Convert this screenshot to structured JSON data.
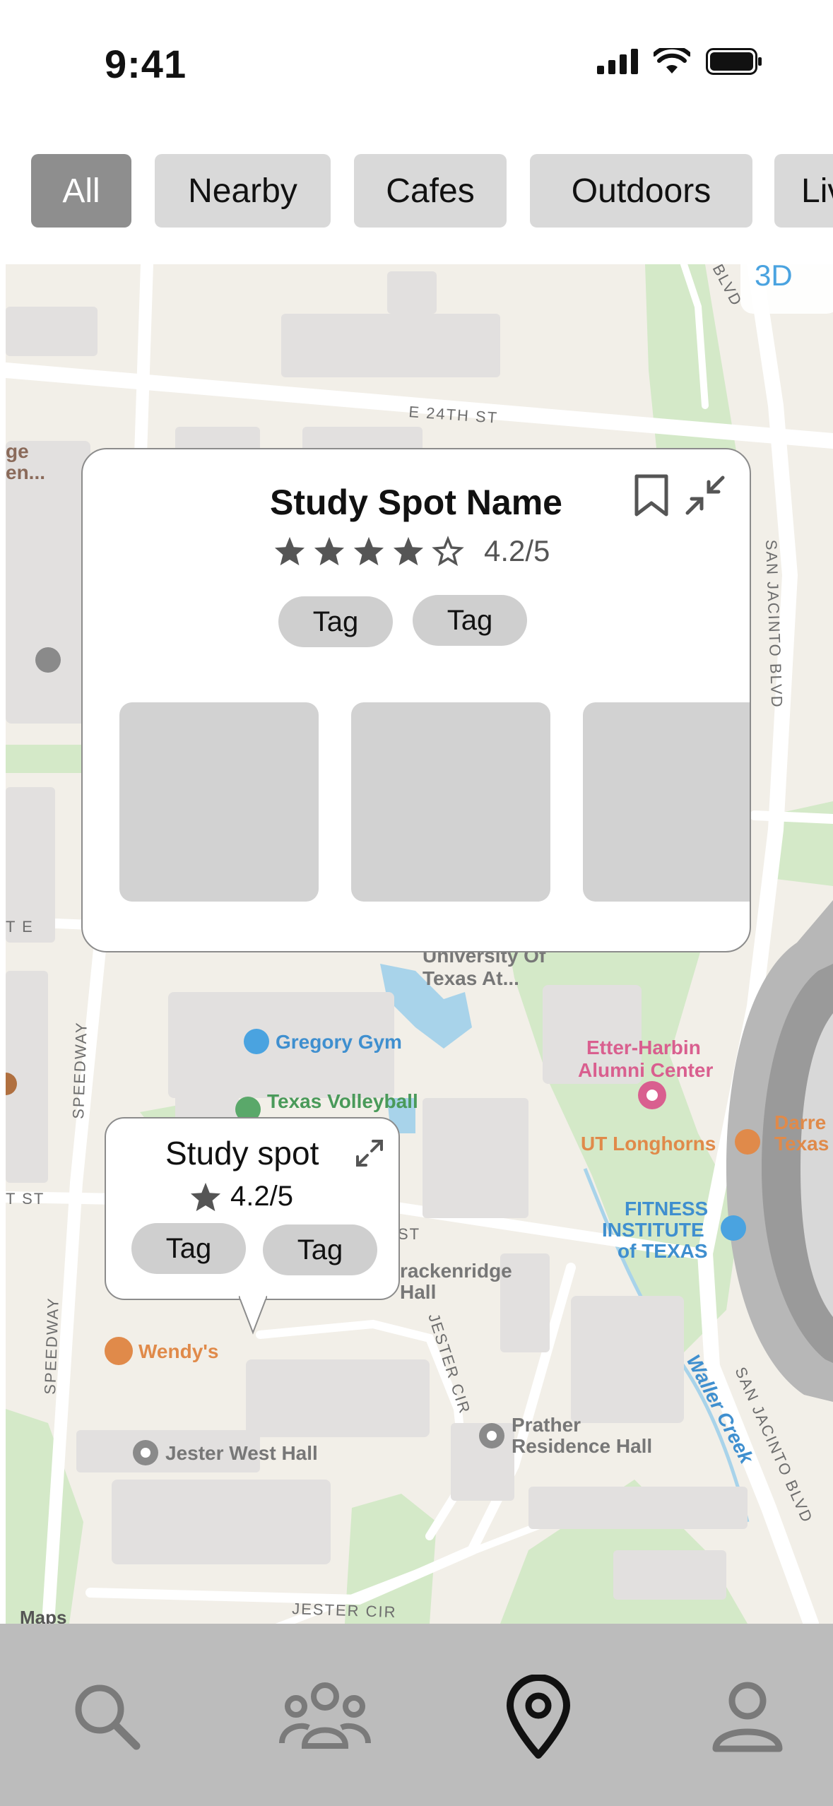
{
  "status_bar": {
    "time": "9:41"
  },
  "filters": {
    "chips": [
      {
        "label": "All",
        "active": true
      },
      {
        "label": "Nearby",
        "active": false
      },
      {
        "label": "Cafes",
        "active": false
      },
      {
        "label": "Outdoors",
        "active": false
      },
      {
        "label": "Liv",
        "active": false
      }
    ]
  },
  "map": {
    "badge_3d": "3D",
    "labels": {
      "e24th": "E 24TH ST",
      "san_jacinto_1": "SAN JACINTO BLVD",
      "san_jacinto_2": "SAN JACINTO BLVD",
      "blvd": "BLVD",
      "speedway_1": "SPEEDWAY",
      "speedway_2": "SPEEDWAY",
      "jester_cir_1": "JESTER CIR",
      "jester_cir_2": "JESTER CIR",
      "st_left": "T ST",
      "st_mid": "ST",
      "e_left": "T E",
      "ge": "ge",
      "en": "en...",
      "university": "University Of",
      "texas_at": "Texas At...",
      "gregory_gym": "Gregory Gym",
      "texas_volleyball": "Texas Volleyball",
      "etter_harbin_1": "Etter-Harbin",
      "etter_harbin_2": "Alumni Center",
      "ut_longhorns": "UT Longhorns",
      "fitness_1": "FITNESS",
      "fitness_2": "INSTITUTE",
      "fitness_3": "of TEXAS",
      "brackenridge_1": "rackenridge",
      "brackenridge_2": "Hall",
      "wendys": "Wendy's",
      "jester_west": "Jester West Hall",
      "prather_1": "Prather",
      "prather_2": "Residence Hall",
      "waller_creek": "Waller Creek",
      "darre": "Darre",
      "texas_r": "Texas",
      "maps_attr": "Maps"
    }
  },
  "expanded_card": {
    "title": "Study Spot Name",
    "rating_text": "4.2/5",
    "stars_filled": 4,
    "tags": [
      "Tag",
      "Tag"
    ]
  },
  "compact_card": {
    "title": "Study spot",
    "rating_text": "4.2/5",
    "tags": [
      "Tag",
      "Tag"
    ]
  },
  "colors": {
    "map_bg": "#f2efe8",
    "park_green": "#cfe8c4",
    "water_blue": "#9fcfe8",
    "poi_blue": "#4aa3e0",
    "poi_orange": "#e08a4a",
    "poi_pink": "#d95f8f"
  },
  "tab_bar": {
    "tabs": [
      {
        "icon": "search-icon",
        "active": false
      },
      {
        "icon": "community-icon",
        "active": false
      },
      {
        "icon": "map-pin-icon",
        "active": true
      },
      {
        "icon": "profile-icon",
        "active": false
      }
    ]
  }
}
